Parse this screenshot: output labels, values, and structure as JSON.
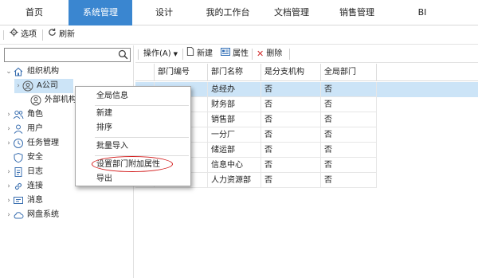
{
  "nav": {
    "tabs": [
      {
        "label": "首页"
      },
      {
        "label": "系统管理"
      },
      {
        "label": "设计"
      },
      {
        "label": "我的工作台"
      },
      {
        "label": "文档管理"
      },
      {
        "label": "销售管理"
      },
      {
        "label": "BI"
      }
    ],
    "active_index": 1
  },
  "toolbar": {
    "options_label": "选项",
    "refresh_label": "刷新"
  },
  "search": {
    "value": "",
    "placeholder": ""
  },
  "tree": {
    "items": [
      {
        "label": "组织机构",
        "icon": "home-icon",
        "expanded": true
      },
      {
        "label": "A公司",
        "icon": "org-person-icon",
        "selected": true
      },
      {
        "label": "外部机构",
        "icon": "org-person-icon"
      },
      {
        "label": "角色",
        "icon": "users-icon"
      },
      {
        "label": "用户",
        "icon": "user-icon"
      },
      {
        "label": "任务管理",
        "icon": "clock-icon"
      },
      {
        "label": "安全",
        "icon": "shield-icon"
      },
      {
        "label": "日志",
        "icon": "document-icon"
      },
      {
        "label": "连接",
        "icon": "link-icon"
      },
      {
        "label": "消息",
        "icon": "message-icon"
      },
      {
        "label": "网盘系统",
        "icon": "cloud-icon"
      }
    ]
  },
  "actions": {
    "operate_label": "操作(A)",
    "new_label": "新建",
    "properties_label": "属性",
    "delete_label": "删除"
  },
  "table": {
    "columns": [
      "部门编号",
      "部门名称",
      "是分支机构",
      "全局部门"
    ],
    "rows": [
      {
        "name": "总经办",
        "branch": "否",
        "global": "否",
        "selected": true
      },
      {
        "name": "财务部",
        "branch": "否",
        "global": "否"
      },
      {
        "name": "销售部",
        "branch": "否",
        "global": "否"
      },
      {
        "name": "一分厂",
        "branch": "否",
        "global": "否"
      },
      {
        "name": "储运部",
        "branch": "否",
        "global": "否"
      },
      {
        "name": "信息中心",
        "branch": "否",
        "global": "否"
      },
      {
        "name": "人力资源部",
        "branch": "否",
        "global": "否"
      }
    ]
  },
  "context_menu": {
    "items": [
      "全局信息",
      "新建",
      "排序",
      "批量导入",
      "设置部门附加属性",
      "导出"
    ],
    "highlight_color": "#d21a1a"
  },
  "colors": {
    "accent": "#3a86d0",
    "selection": "#cce4f7"
  }
}
